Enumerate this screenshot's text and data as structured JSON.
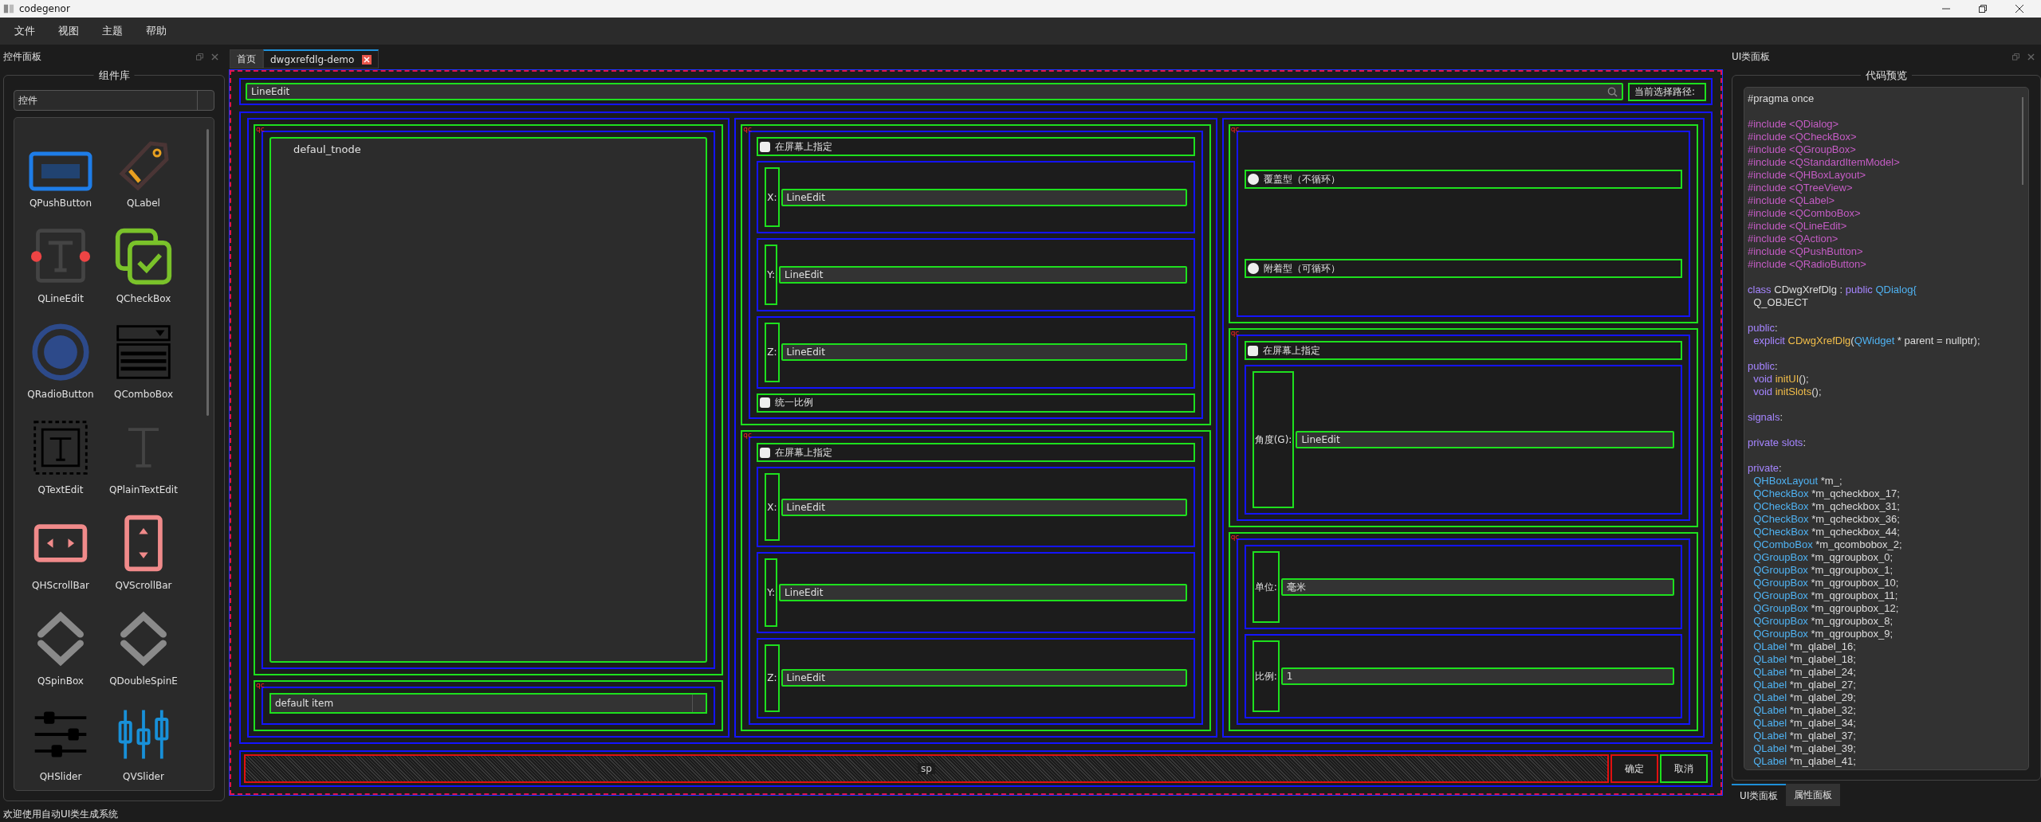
{
  "window": {
    "title": "codegenor"
  },
  "menu": [
    "文件",
    "视图",
    "主题",
    "帮助"
  ],
  "left_panel": {
    "title": "控件面板",
    "group_title": "组件库",
    "category": "控件",
    "widgets": [
      {
        "label": "QPushButton",
        "kind": "pushbutton"
      },
      {
        "label": "QLabel",
        "kind": "label"
      },
      {
        "label": "QLineEdit",
        "kind": "lineedit"
      },
      {
        "label": "QCheckBox",
        "kind": "checkbox"
      },
      {
        "label": "QRadioButton",
        "kind": "radio"
      },
      {
        "label": "QComboBox",
        "kind": "combobox"
      },
      {
        "label": "QTextEdit",
        "kind": "textedit"
      },
      {
        "label": "QPlainTextEdit",
        "kind": "plaintext"
      },
      {
        "label": "QHScrollBar",
        "kind": "hscroll"
      },
      {
        "label": "QVScrollBar",
        "kind": "vscroll"
      },
      {
        "label": "QSpinBox",
        "kind": "spin"
      },
      {
        "label": "QDoubleSpinE",
        "kind": "spin"
      },
      {
        "label": "QHSlider",
        "kind": "hslider"
      },
      {
        "label": "QVSlider",
        "kind": "vslider"
      }
    ]
  },
  "tabs": [
    {
      "label": "首页",
      "selected": false,
      "closable": false
    },
    {
      "label": "dwgxrefdlg-demo",
      "selected": true,
      "closable": true
    }
  ],
  "canvas": {
    "path_edit": "LineEdit",
    "path_label": "当前选择路径:",
    "tree": {
      "tag": "qc",
      "nodes": [
        "defaul_tnode"
      ]
    },
    "combo": {
      "tag": "qc",
      "value": "default item"
    },
    "columns": [
      [
        {
          "tag": "qc",
          "rows": [
            {
              "kind": "checkbox",
              "label": "在屏幕上指定",
              "checked": false
            },
            {
              "kind": "field",
              "label": "X:",
              "value": "LineEdit"
            },
            {
              "kind": "field",
              "label": "Y:",
              "value": "LineEdit"
            },
            {
              "kind": "field",
              "label": "Z:",
              "value": "LineEdit"
            },
            {
              "kind": "checkbox",
              "label": "统一比例",
              "checked": false
            }
          ]
        },
        {
          "tag": "qc",
          "rows": [
            {
              "kind": "checkbox",
              "label": "在屏幕上指定",
              "checked": false
            },
            {
              "kind": "field",
              "label": "X:",
              "value": "LineEdit"
            },
            {
              "kind": "field",
              "label": "Y:",
              "value": "LineEdit"
            },
            {
              "kind": "field",
              "label": "Z:",
              "value": "LineEdit"
            }
          ]
        }
      ],
      [
        {
          "tag": "qc",
          "rows": [
            {
              "kind": "radio",
              "label": "覆盖型（不循环）",
              "checked": false
            },
            {
              "kind": "radio",
              "label": "附着型（可循环）",
              "checked": false
            }
          ]
        },
        {
          "tag": "qc",
          "rows": [
            {
              "kind": "checkbox",
              "label": "在屏幕上指定",
              "checked": false
            },
            {
              "kind": "field",
              "label": "角度(G):",
              "value": "LineEdit"
            }
          ]
        },
        {
          "tag": "qc",
          "rows": [
            {
              "kind": "field",
              "label": "单位:",
              "value": "毫米"
            },
            {
              "kind": "field",
              "label": "比例:",
              "value": "1"
            }
          ]
        }
      ]
    ],
    "spacer": "sp",
    "buttons": [
      {
        "label": "确定",
        "focused": true
      },
      {
        "label": "取消",
        "focused": false
      }
    ]
  },
  "right_panel": {
    "title": "UI类面板",
    "group_title": "代码预览",
    "code": [
      {
        "gap": false,
        "parts": [
          {
            "kind": "plain",
            "t": "#pragma once"
          }
        ]
      },
      {
        "gap": true,
        "parts": [
          {
            "kind": "pre",
            "t": "#include <QDialog>"
          }
        ]
      },
      {
        "gap": false,
        "parts": [
          {
            "kind": "pre",
            "t": "#include <QCheckBox>"
          }
        ]
      },
      {
        "gap": false,
        "parts": [
          {
            "kind": "pre",
            "t": "#include <QGroupBox>"
          }
        ]
      },
      {
        "gap": false,
        "parts": [
          {
            "kind": "pre",
            "t": "#include <QStandardItemModel>"
          }
        ]
      },
      {
        "gap": false,
        "parts": [
          {
            "kind": "pre",
            "t": "#include <QHBoxLayout>"
          }
        ]
      },
      {
        "gap": false,
        "parts": [
          {
            "kind": "pre",
            "t": "#include <QTreeView>"
          }
        ]
      },
      {
        "gap": false,
        "parts": [
          {
            "kind": "pre",
            "t": "#include <QLabel>"
          }
        ]
      },
      {
        "gap": false,
        "parts": [
          {
            "kind": "pre",
            "t": "#include <QComboBox>"
          }
        ]
      },
      {
        "gap": false,
        "parts": [
          {
            "kind": "pre",
            "t": "#include <QLineEdit>"
          }
        ]
      },
      {
        "gap": false,
        "parts": [
          {
            "kind": "pre",
            "t": "#include <QAction>"
          }
        ]
      },
      {
        "gap": false,
        "parts": [
          {
            "kind": "pre",
            "t": "#include <QPushButton>"
          }
        ]
      },
      {
        "gap": false,
        "parts": [
          {
            "kind": "pre",
            "t": "#include <QRadioButton>"
          }
        ]
      },
      {
        "gap": true,
        "parts": [
          {
            "kind": "kw",
            "t": "class"
          },
          {
            "kind": "plain",
            "t": " CDwgXrefDlg : "
          },
          {
            "kind": "kw",
            "t": "public"
          },
          {
            "kind": "type",
            "t": " QDialog{"
          }
        ]
      },
      {
        "gap": false,
        "parts": [
          {
            "kind": "plain",
            "t": "  Q_OBJECT"
          }
        ]
      },
      {
        "gap": true,
        "parts": [
          {
            "kind": "kw",
            "t": "public"
          },
          {
            "kind": "plain",
            "t": ":"
          }
        ]
      },
      {
        "gap": false,
        "parts": [
          {
            "kind": "kw",
            "t": "  explicit"
          },
          {
            "kind": "fn",
            "t": " CDwgXrefDlg"
          },
          {
            "kind": "plain",
            "t": "("
          },
          {
            "kind": "type",
            "t": "QWidget"
          },
          {
            "kind": "plain",
            "t": " * parent = nullptr);"
          }
        ]
      },
      {
        "gap": true,
        "parts": [
          {
            "kind": "kw",
            "t": "public"
          },
          {
            "kind": "plain",
            "t": ":"
          }
        ]
      },
      {
        "gap": false,
        "parts": [
          {
            "kind": "kw",
            "t": "  void"
          },
          {
            "kind": "fn",
            "t": " initUI"
          },
          {
            "kind": "plain",
            "t": "();"
          }
        ]
      },
      {
        "gap": false,
        "parts": [
          {
            "kind": "kw",
            "t": "  void"
          },
          {
            "kind": "fn",
            "t": " initSlots"
          },
          {
            "kind": "plain",
            "t": "();"
          }
        ]
      },
      {
        "gap": true,
        "parts": [
          {
            "kind": "kw",
            "t": "signals"
          },
          {
            "kind": "plain",
            "t": ":"
          }
        ]
      },
      {
        "gap": true,
        "parts": [
          {
            "kind": "kw",
            "t": "private slots"
          },
          {
            "kind": "plain",
            "t": ":"
          }
        ]
      },
      {
        "gap": true,
        "parts": [
          {
            "kind": "kw",
            "t": "private"
          },
          {
            "kind": "plain",
            "t": ":"
          }
        ]
      },
      {
        "gap": false,
        "parts": [
          {
            "kind": "type",
            "t": "  QHBoxLayout"
          },
          {
            "kind": "plain",
            "t": " *m_;"
          }
        ]
      },
      {
        "gap": false,
        "parts": [
          {
            "kind": "type",
            "t": "  QCheckBox"
          },
          {
            "kind": "plain",
            "t": " *m_qcheckbox_17;"
          }
        ]
      },
      {
        "gap": false,
        "parts": [
          {
            "kind": "type",
            "t": "  QCheckBox"
          },
          {
            "kind": "plain",
            "t": " *m_qcheckbox_31;"
          }
        ]
      },
      {
        "gap": false,
        "parts": [
          {
            "kind": "type",
            "t": "  QCheckBox"
          },
          {
            "kind": "plain",
            "t": " *m_qcheckbox_36;"
          }
        ]
      },
      {
        "gap": false,
        "parts": [
          {
            "kind": "type",
            "t": "  QCheckBox"
          },
          {
            "kind": "plain",
            "t": " *m_qcheckbox_44;"
          }
        ]
      },
      {
        "gap": false,
        "parts": [
          {
            "kind": "type",
            "t": "  QComboBox"
          },
          {
            "kind": "plain",
            "t": " *m_qcombobox_2;"
          }
        ]
      },
      {
        "gap": false,
        "parts": [
          {
            "kind": "type",
            "t": "  QGroupBox"
          },
          {
            "kind": "plain",
            "t": " *m_qgroupbox_0;"
          }
        ]
      },
      {
        "gap": false,
        "parts": [
          {
            "kind": "type",
            "t": "  QGroupBox"
          },
          {
            "kind": "plain",
            "t": " *m_qgroupbox_1;"
          }
        ]
      },
      {
        "gap": false,
        "parts": [
          {
            "kind": "type",
            "t": "  QGroupBox"
          },
          {
            "kind": "plain",
            "t": " *m_qgroupbox_10;"
          }
        ]
      },
      {
        "gap": false,
        "parts": [
          {
            "kind": "type",
            "t": "  QGroupBox"
          },
          {
            "kind": "plain",
            "t": " *m_qgroupbox_11;"
          }
        ]
      },
      {
        "gap": false,
        "parts": [
          {
            "kind": "type",
            "t": "  QGroupBox"
          },
          {
            "kind": "plain",
            "t": " *m_qgroupbox_12;"
          }
        ]
      },
      {
        "gap": false,
        "parts": [
          {
            "kind": "type",
            "t": "  QGroupBox"
          },
          {
            "kind": "plain",
            "t": " *m_qgroupbox_8;"
          }
        ]
      },
      {
        "gap": false,
        "parts": [
          {
            "kind": "type",
            "t": "  QGroupBox"
          },
          {
            "kind": "plain",
            "t": " *m_qgroupbox_9;"
          }
        ]
      },
      {
        "gap": false,
        "parts": [
          {
            "kind": "type",
            "t": "  QLabel"
          },
          {
            "kind": "plain",
            "t": " *m_qlabel_16;"
          }
        ]
      },
      {
        "gap": false,
        "parts": [
          {
            "kind": "type",
            "t": "  QLabel"
          },
          {
            "kind": "plain",
            "t": " *m_qlabel_18;"
          }
        ]
      },
      {
        "gap": false,
        "parts": [
          {
            "kind": "type",
            "t": "  QLabel"
          },
          {
            "kind": "plain",
            "t": " *m_qlabel_24;"
          }
        ]
      },
      {
        "gap": false,
        "parts": [
          {
            "kind": "type",
            "t": "  QLabel"
          },
          {
            "kind": "plain",
            "t": " *m_qlabel_27;"
          }
        ]
      },
      {
        "gap": false,
        "parts": [
          {
            "kind": "type",
            "t": "  QLabel"
          },
          {
            "kind": "plain",
            "t": " *m_qlabel_29;"
          }
        ]
      },
      {
        "gap": false,
        "parts": [
          {
            "kind": "type",
            "t": "  QLabel"
          },
          {
            "kind": "plain",
            "t": " *m_qlabel_32;"
          }
        ]
      },
      {
        "gap": false,
        "parts": [
          {
            "kind": "type",
            "t": "  QLabel"
          },
          {
            "kind": "plain",
            "t": " *m_qlabel_34;"
          }
        ]
      },
      {
        "gap": false,
        "parts": [
          {
            "kind": "type",
            "t": "  QLabel"
          },
          {
            "kind": "plain",
            "t": " *m_qlabel_37;"
          }
        ]
      },
      {
        "gap": false,
        "parts": [
          {
            "kind": "type",
            "t": "  QLabel"
          },
          {
            "kind": "plain",
            "t": " *m_qlabel_39;"
          }
        ]
      },
      {
        "gap": false,
        "parts": [
          {
            "kind": "type",
            "t": "  QLabel"
          },
          {
            "kind": "plain",
            "t": " *m_qlabel_41;"
          }
        ]
      }
    ],
    "tabs": [
      {
        "label": "UI类面板",
        "selected": true
      },
      {
        "label": "属性面板",
        "selected": false
      }
    ]
  },
  "status_bar": "欢迎使用自动UI类生成系统"
}
